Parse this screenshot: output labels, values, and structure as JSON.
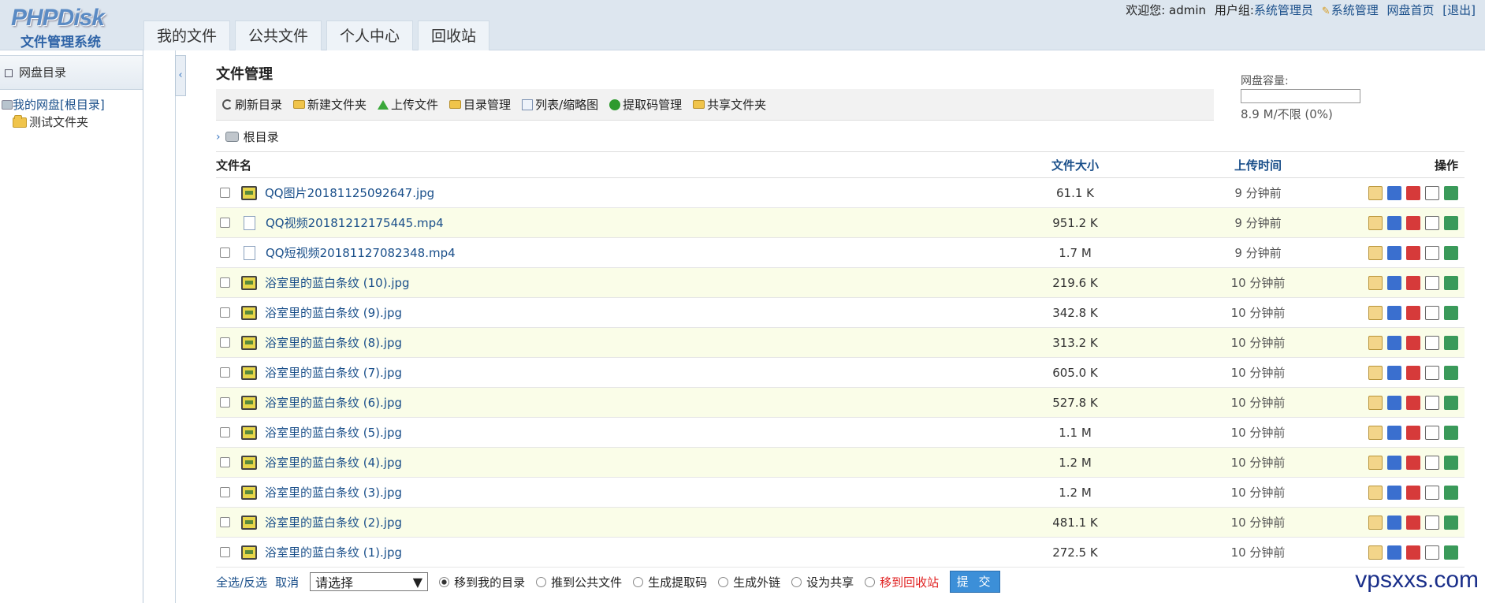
{
  "logo": {
    "line1": "PHPDisk",
    "line2": "文件管理系统"
  },
  "nav": {
    "tabs": [
      "我的文件",
      "公共文件",
      "个人中心",
      "回收站"
    ]
  },
  "userbar": {
    "welcome": "欢迎您: admin",
    "group_label": "用户组:",
    "group": "系统管理员",
    "admin": "系统管理",
    "home": "网盘首页",
    "logout": "[退出]"
  },
  "sidebar": {
    "title": "网盘目录",
    "root": "我的网盘[根目录]",
    "child": "测试文件夹"
  },
  "main": {
    "title": "文件管理",
    "toolbar": [
      "刷新目录",
      "新建文件夹",
      "上传文件",
      "目录管理",
      "列表/缩略图",
      "提取码管理",
      "共享文件夹"
    ],
    "quota_label": "网盘容量:",
    "quota_text": "8.9 M/不限 (0%)",
    "breadcrumb": "根目录"
  },
  "table": {
    "headers": {
      "name": "文件名",
      "size": "文件大小",
      "time": "上传时间",
      "ops": "操作"
    },
    "rows": [
      {
        "name": "QQ图片20181125092647.jpg",
        "size": "61.1 K",
        "time": "9 分钟前",
        "type": "img"
      },
      {
        "name": "QQ视频20181212175445.mp4",
        "size": "951.2 K",
        "time": "9 分钟前",
        "type": "vid"
      },
      {
        "name": "QQ短视频20181127082348.mp4",
        "size": "1.7 M",
        "time": "9 分钟前",
        "type": "vid"
      },
      {
        "name": "浴室里的蓝白条纹 (10).jpg",
        "size": "219.6 K",
        "time": "10 分钟前",
        "type": "img"
      },
      {
        "name": "浴室里的蓝白条纹 (9).jpg",
        "size": "342.8 K",
        "time": "10 分钟前",
        "type": "img"
      },
      {
        "name": "浴室里的蓝白条纹 (8).jpg",
        "size": "313.2 K",
        "time": "10 分钟前",
        "type": "img"
      },
      {
        "name": "浴室里的蓝白条纹 (7).jpg",
        "size": "605.0 K",
        "time": "10 分钟前",
        "type": "img"
      },
      {
        "name": "浴室里的蓝白条纹 (6).jpg",
        "size": "527.8 K",
        "time": "10 分钟前",
        "type": "img"
      },
      {
        "name": "浴室里的蓝白条纹 (5).jpg",
        "size": "1.1 M",
        "time": "10 分钟前",
        "type": "img"
      },
      {
        "name": "浴室里的蓝白条纹 (4).jpg",
        "size": "1.2 M",
        "time": "10 分钟前",
        "type": "img"
      },
      {
        "name": "浴室里的蓝白条纹 (3).jpg",
        "size": "1.2 M",
        "time": "10 分钟前",
        "type": "img"
      },
      {
        "name": "浴室里的蓝白条纹 (2).jpg",
        "size": "481.1 K",
        "time": "10 分钟前",
        "type": "img"
      },
      {
        "name": "浴室里的蓝白条纹 (1).jpg",
        "size": "272.5 K",
        "time": "10 分钟前",
        "type": "img"
      }
    ]
  },
  "bottom": {
    "select_all": "全选/反选",
    "cancel": "取消",
    "select_placeholder": "请选择",
    "radios": [
      "移到我的目录",
      "推到公共文件",
      "生成提取码",
      "生成外链",
      "设为共享",
      "移到回收站"
    ],
    "submit": "提 交"
  },
  "watermark": "vpsxxs.com"
}
